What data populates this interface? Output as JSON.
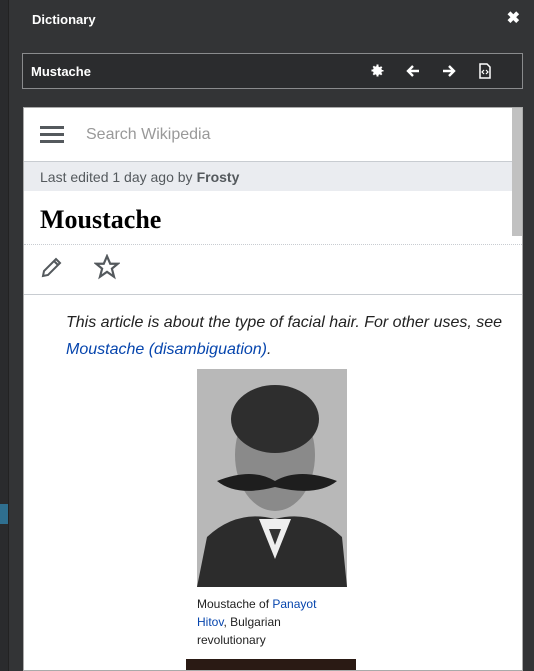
{
  "window": {
    "title": "Dictionary"
  },
  "search": {
    "value": "Mustache"
  },
  "toolbar": {
    "icons": [
      "gear-icon",
      "arrow-left-icon",
      "arrow-right-icon",
      "source-file-icon"
    ]
  },
  "wikipedia": {
    "search_placeholder": "Search Wikipedia",
    "last_edited_prefix": "Last edited 1 day ago by",
    "last_edited_user": "Frosty",
    "article_title": "Moustache",
    "hatnote_text": "This article is about the type of facial hair. For other uses, see",
    "hatnote_link": "Moustache (disambiguation)",
    "hatnote_end": ".",
    "caption_prefix": "Moustache of ",
    "caption_link": "Panayot Hitov",
    "caption_suffix": ", Bulgarian revolutionary"
  }
}
